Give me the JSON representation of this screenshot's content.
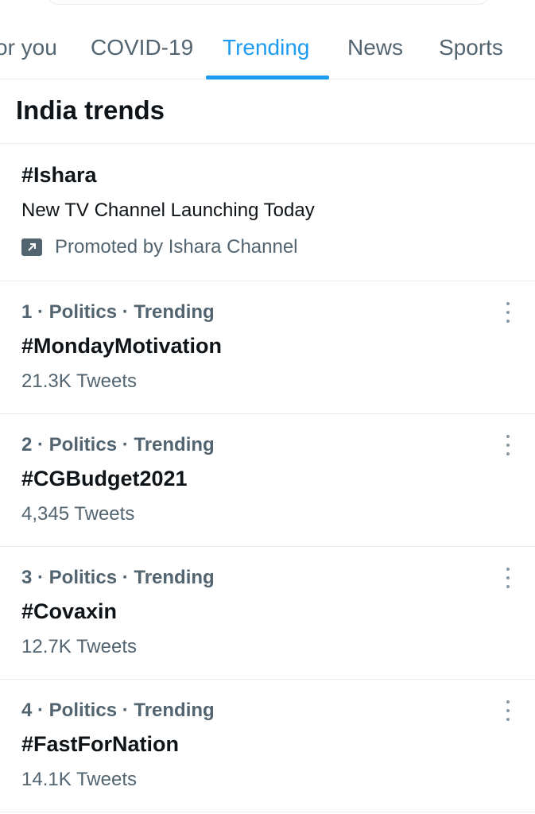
{
  "tabs": [
    {
      "label": "or you",
      "active": false
    },
    {
      "label": "COVID-19",
      "active": false
    },
    {
      "label": "Trending",
      "active": true
    },
    {
      "label": "News",
      "active": false
    },
    {
      "label": "Sports",
      "active": false
    }
  ],
  "section_title": "India trends",
  "promoted": {
    "hashtag": "#Ishara",
    "description": "New TV Channel Launching Today",
    "promoted_by": "Promoted by Ishara Channel",
    "icon": "promoted-arrow-icon"
  },
  "trends": [
    {
      "meta": "1 · Politics · Trending",
      "name": "#MondayMotivation",
      "count": "21.3K Tweets"
    },
    {
      "meta": "2 · Politics · Trending",
      "name": "#CGBudget2021",
      "count": "4,345 Tweets"
    },
    {
      "meta": "3 · Politics · Trending",
      "name": "#Covaxin",
      "count": "12.7K Tweets"
    },
    {
      "meta": "4 · Politics · Trending",
      "name": "#FastForNation",
      "count": "14.1K Tweets"
    }
  ],
  "colors": {
    "accent": "#1d9bf0",
    "secondary_text": "#536471",
    "divider": "#e6ecf0"
  }
}
